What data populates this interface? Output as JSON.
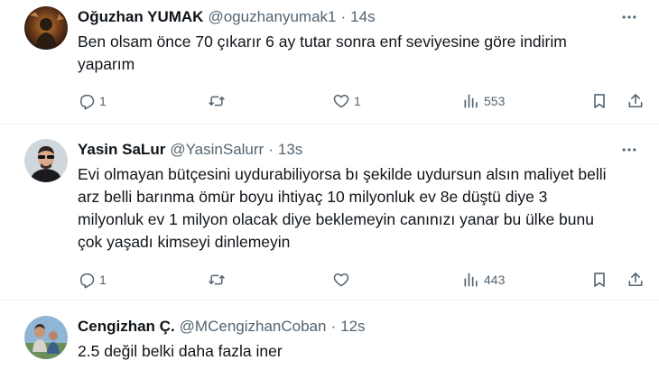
{
  "tweets": [
    {
      "name": "Oğuzhan YUMAK",
      "handle": "@oguzhanyumak1",
      "separator": "·",
      "time": "14s",
      "lines": [
        "Ben olsam önce 70 çıkarır 6 ay tutar sonra enf seviyesine göre indirim",
        "yaparım"
      ],
      "reply_count": "1",
      "retweet_count": "",
      "like_count": "1",
      "view_count": "553",
      "avatar_icon": "avatar-photo"
    },
    {
      "name": "Yasin SaLur",
      "handle": "@YasinSalurr",
      "separator": "·",
      "time": "13s",
      "lines": [
        "Evi olmayan bütçesini uydurabiliyorsa bı şekilde uydursun alsın maliyet belli",
        "arz belli barınma ömür boyu ihtiyaç 10 milyonluk ev 8e düştü diye 3",
        "milyonluk ev 1 milyon olacak diye beklemeyin canınızı yanar bu ülke bunu",
        "çok yaşadı kimseyi dinlemeyin"
      ],
      "reply_count": "1",
      "retweet_count": "",
      "like_count": "",
      "view_count": "443",
      "avatar_icon": "avatar-photo"
    },
    {
      "name": "Cengizhan Ç.",
      "handle": "@MCengizhanCoban",
      "separator": "·",
      "time": "12s",
      "lines": [
        "2.5 değil belki daha fazla iner"
      ],
      "avatar_icon": "avatar-photo"
    }
  ],
  "colors": {
    "text": "#0f1419",
    "secondary": "#536471",
    "divider": "#eff3f4"
  },
  "icons": {
    "reply": "reply-icon",
    "retweet": "retweet-icon",
    "like": "heart-icon",
    "views": "views-icon",
    "bookmark": "bookmark-icon",
    "share": "share-icon",
    "more": "more-icon"
  }
}
